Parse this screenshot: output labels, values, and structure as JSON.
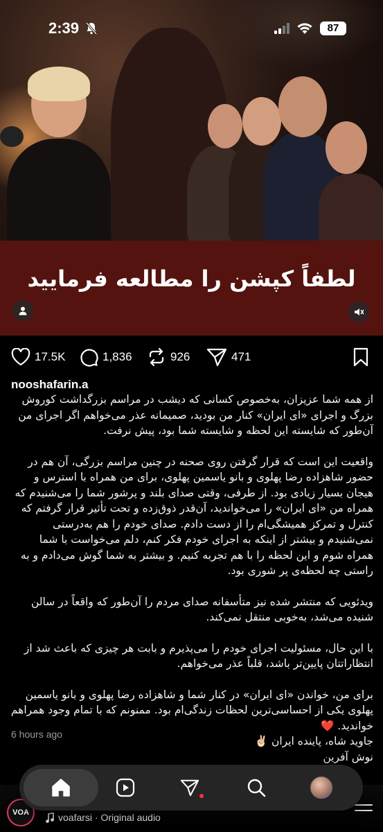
{
  "status_bar": {
    "time": "2:39",
    "battery": "87",
    "icons": [
      "bell-slash-icon",
      "signal-icon",
      "wifi-icon",
      "battery-icon"
    ]
  },
  "post": {
    "banner_title": "لطفاً کپشن را مطالعه فرمایید",
    "likes": "17.5K",
    "comments": "1,836",
    "reposts": "926",
    "shares": "471",
    "username": "nooshafarin.a",
    "caption": {
      "p1": "از همه شما عزیزان، به‌خصوص کسانی که دیشب در مراسم بزرگداشت کوروش بزرگ و اجرای «ای ایران» کنار من بودید، صمیمانه عذر می‌خواهم اگر اجرای من آن‌طور که شایسته این لحظه و شایسته شما بود، پیش نرفت.",
      "p2": "واقعیت این است که قرار گرفتن روی صحنه در چنین مراسم بزرگی، آن هم در حضور شاهزاده رضا پهلوی و بانو یاسمین پهلوی، برای من همراه با استرس و هیجان بسیار زیادی بود. از طرفی، وقتی صدای بلند و پرشور شما را می‌شنیدم که همراه من «ای ایران» را می‌خواندید، آن‌قدر ذوق‌زده و تحت تأثیر قرار گرفتم که کنترل و تمرکز همیشگی‌ام را از دست دادم. صدای خودم را هم به‌درستی نمی‌شنیدم و بیشتر از اینکه به اجرای خودم فکر کنم، دلم می‌خواست با شما همراه شوم و این لحظه را با هم تجربه کنیم. و بیشتر به شما گوش می‌دادم و به راستی چه لحظه‌ی پر شوری بود.",
      "p3": "ویدئویی که منتشر شده نیز متأسفانه صدای مردم را آن‌طور که واقعاً در سالن شنیده می‌شد، به‌خوبی منتقل نمی‌کند.",
      "p4": "با این حال، مسئولیت اجرای خودم را می‌پذیرم و بابت هر چیزی که باعث شد از انتظاراتتان پایین‌تر باشد، قلباً عذر می‌خواهم.",
      "p5": "برای من، خواندن «ای ایران» در کنار شما و شاهزاده رضا پهلوی و بانو یاسمین پهلوی یکی از احساسی‌ترین لحظات زندگی‌ام بود. ممنونم که با تمام وجود همراهم خواندید. ❤️",
      "p6": "جاوید شاه، پاینده ایران ✌🏻",
      "p7": "نوش آفرین"
    },
    "time_ago": "6 hours ago"
  },
  "audio": {
    "logo": "VOA",
    "text": "voafarsi · Original audio"
  },
  "nav": {
    "items": [
      "home-icon",
      "reels-icon",
      "send-icon",
      "search-icon",
      "profile-avatar"
    ]
  },
  "colors": {
    "banner": "#54130f",
    "background": "#000000",
    "notification_dot": "#ff3040"
  }
}
